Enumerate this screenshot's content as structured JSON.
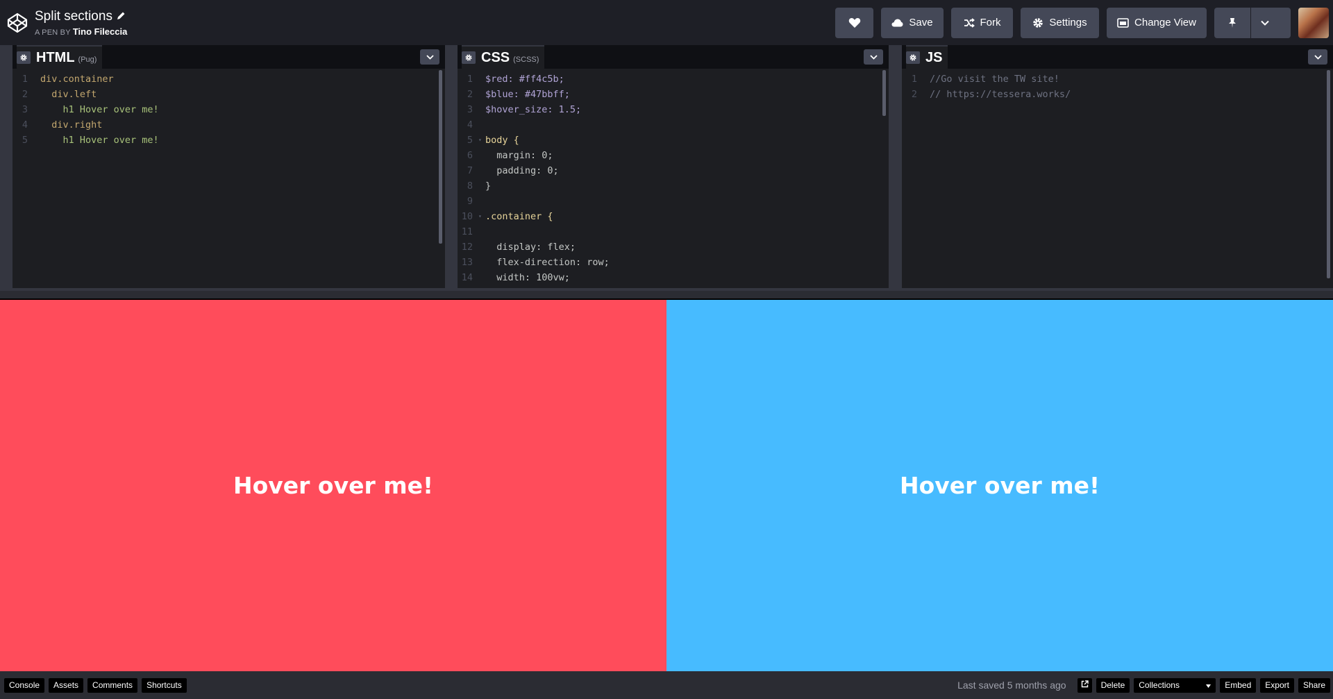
{
  "header": {
    "pen_title": "Split sections",
    "pen_by_label": "A PEN BY",
    "author": "Tino Fileccia",
    "buttons": {
      "save": "Save",
      "fork": "Fork",
      "settings": "Settings",
      "change_view": "Change View"
    }
  },
  "editors": {
    "html": {
      "lang": "HTML",
      "preprocessor": "(Pug)",
      "lines": [
        {
          "n": "1",
          "t": "div.container"
        },
        {
          "n": "2",
          "t": "  div.left"
        },
        {
          "n": "3",
          "t": "    h1 Hover over me!"
        },
        {
          "n": "4",
          "t": "  div.right"
        },
        {
          "n": "5",
          "t": "    h1 Hover over me!"
        }
      ]
    },
    "css": {
      "lang": "CSS",
      "preprocessor": "(SCSS)",
      "lines": [
        {
          "n": "1",
          "t": "$red: #ff4c5b;"
        },
        {
          "n": "2",
          "t": "$blue: #47bbff;"
        },
        {
          "n": "3",
          "t": "$hover_size: 1.5;"
        },
        {
          "n": "4",
          "t": ""
        },
        {
          "n": "5",
          "t": "body {"
        },
        {
          "n": "6",
          "t": "  margin: 0;"
        },
        {
          "n": "7",
          "t": "  padding: 0;"
        },
        {
          "n": "8",
          "t": "}"
        },
        {
          "n": "9",
          "t": ""
        },
        {
          "n": "10",
          "t": ".container {"
        },
        {
          "n": "11",
          "t": ""
        },
        {
          "n": "12",
          "t": "  display: flex;"
        },
        {
          "n": "13",
          "t": "  flex-direction: row;"
        },
        {
          "n": "14",
          "t": "  width: 100vw;"
        }
      ]
    },
    "js": {
      "lang": "JS",
      "lines": [
        {
          "n": "1",
          "t": "//Go visit the TW site!"
        },
        {
          "n": "2",
          "t": "// https://tessera.works/"
        }
      ]
    }
  },
  "preview": {
    "left_heading": "Hover over me!",
    "right_heading": "Hover over me!",
    "left_color": "#ff4c5b",
    "right_color": "#47bbff"
  },
  "footer": {
    "console": "Console",
    "assets": "Assets",
    "comments": "Comments",
    "shortcuts": "Shortcuts",
    "last_saved_label": "Last saved",
    "last_saved_when": "5 months ago",
    "delete": "Delete",
    "collections": "Collections",
    "embed": "Embed",
    "export": "Export",
    "share": "Share"
  },
  "colors": {
    "bg": "#1e1f26",
    "button": "#444857",
    "editor_bg": "#1d1e22"
  }
}
